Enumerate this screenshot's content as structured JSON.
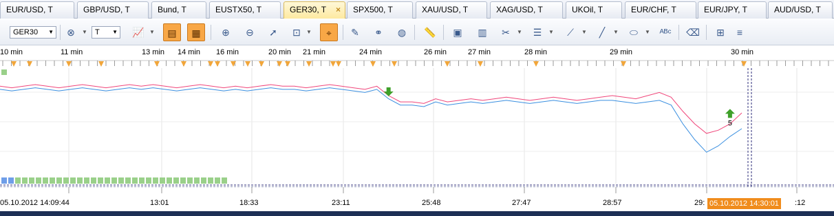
{
  "tabs": [
    {
      "label": "EUR/USD, T"
    },
    {
      "label": "GBP/USD, T"
    },
    {
      "label": "Bund, T"
    },
    {
      "label": "EUSTX50, T"
    },
    {
      "label": "GER30, T"
    },
    {
      "label": "SPX500, T"
    },
    {
      "label": "XAU/USD, T"
    },
    {
      "label": "XAG/USD, T"
    },
    {
      "label": "UKOil, T"
    },
    {
      "label": "EUR/CHF, T"
    },
    {
      "label": "EUR/JPY, T"
    },
    {
      "label": "AUD/USD, T"
    }
  ],
  "active_tab_index": 4,
  "tab_close_glyph": "×",
  "toolbar": {
    "instrument": "GER30",
    "period": "T"
  },
  "time_labels": [
    "10 min",
    "11 min",
    "13 min",
    "14 min",
    "16 min",
    "20 min",
    "21 min",
    "24 min",
    "26 min",
    "27 min",
    "28 min",
    "29 min",
    "30 min"
  ],
  "bottom_labels": [
    "05.10.2012 14:09:44",
    "13:01",
    "18:33",
    "23:11",
    "25:48",
    "27:47",
    "28:57",
    "29:",
    ":12"
  ],
  "cursor_time": "05.10.2012 14:30:01",
  "chart_data": {
    "type": "line",
    "series": [
      {
        "values": [
          62,
          61,
          62,
          63,
          62,
          61,
          62,
          63,
          62,
          61,
          62,
          63,
          62,
          63,
          62,
          61,
          62,
          63,
          62,
          61,
          62,
          61,
          62,
          63,
          62,
          62,
          61,
          62,
          63,
          62,
          61,
          60,
          62,
          56,
          52,
          52,
          51,
          54,
          52,
          53,
          54,
          53,
          54,
          55,
          54,
          53,
          54,
          55,
          54,
          53,
          54,
          55,
          56,
          55,
          54,
          56,
          58,
          55,
          46,
          38,
          32,
          34,
          38,
          45
        ]
      },
      {
        "values": [
          60,
          59,
          60,
          61,
          60,
          59,
          60,
          61,
          60,
          59,
          60,
          61,
          60,
          61,
          60,
          59,
          60,
          61,
          60,
          59,
          60,
          59,
          60,
          61,
          60,
          60,
          59,
          60,
          61,
          60,
          59,
          58,
          60,
          54,
          50,
          50,
          49,
          52,
          50,
          51,
          52,
          51,
          52,
          53,
          52,
          51,
          52,
          53,
          52,
          51,
          52,
          53,
          53,
          52,
          51,
          52,
          53,
          50,
          38,
          28,
          20,
          24,
          30,
          35
        ]
      }
    ],
    "colors": [
      "#f0457a",
      "#3a8fe0"
    ],
    "markers": [
      {
        "type": "sell",
        "index": 33,
        "color": "#3fa02a"
      },
      {
        "type": "buy",
        "index": 62,
        "label": "5",
        "color": "#3fa02a"
      }
    ]
  }
}
